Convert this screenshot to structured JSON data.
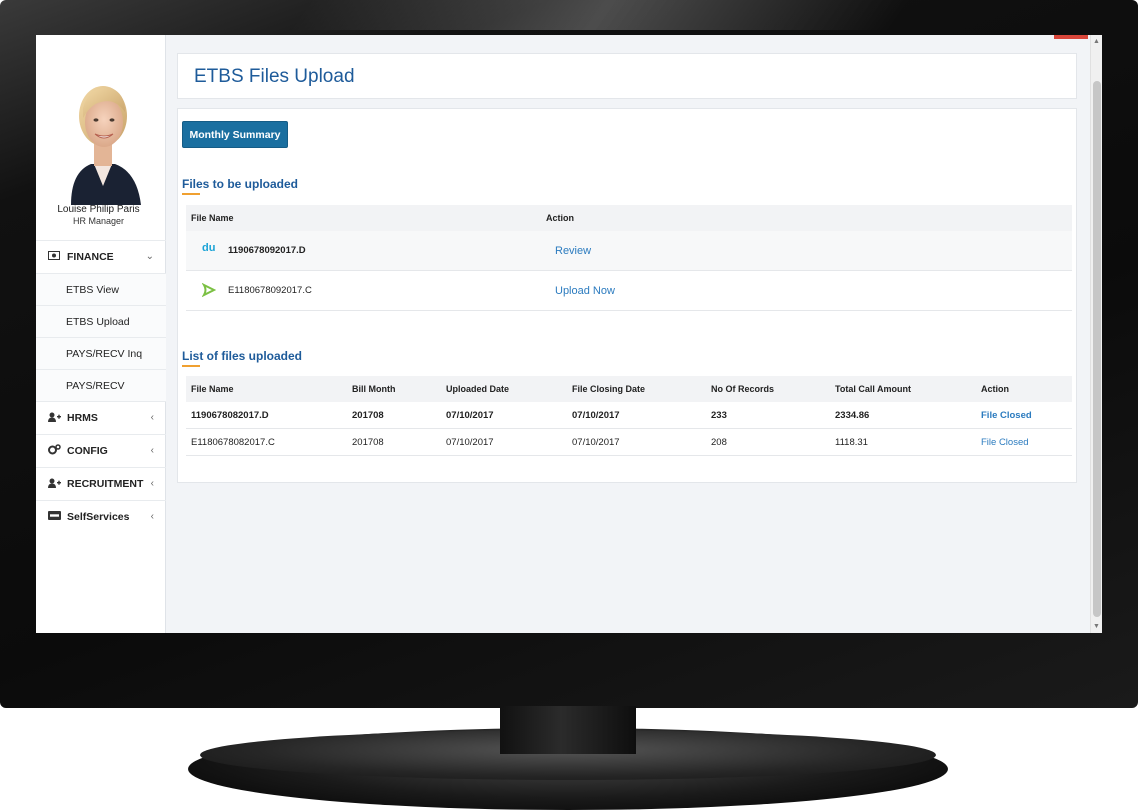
{
  "user": {
    "name": "Louise Philip Paris",
    "role": "HR Manager"
  },
  "sidebar": {
    "items": [
      {
        "label": "FINANCE",
        "icon": "money-icon",
        "chevron": "down"
      },
      {
        "label": "ETBS View"
      },
      {
        "label": "ETBS Upload"
      },
      {
        "label": "PAYS/RECV Inq"
      },
      {
        "label": "PAYS/RECV"
      },
      {
        "label": "HRMS",
        "icon": "user-plus-icon",
        "chevron": "left"
      },
      {
        "label": "CONFIG",
        "icon": "gears-icon",
        "chevron": "left"
      },
      {
        "label": "RECRUITMENT",
        "icon": "user-plus-icon",
        "chevron": "left"
      },
      {
        "label": "SelfServices",
        "icon": "visa-card-icon",
        "chevron": "left"
      }
    ]
  },
  "page": {
    "title": "ETBS Files Upload"
  },
  "actions": {
    "monthly_summary": "Monthly Summary"
  },
  "pending": {
    "title": "Files to be uploaded",
    "columns": {
      "file_name": "File Name",
      "action": "Action"
    },
    "rows": [
      {
        "file_name": "1190678092017.D",
        "action": "Review",
        "provider_icon": "du-icon"
      },
      {
        "file_name": "E1180678092017.C",
        "action": "Upload Now",
        "provider_icon": "etisalat-icon"
      }
    ]
  },
  "uploaded": {
    "title": "List of files uploaded",
    "columns": {
      "file_name": "File Name",
      "bill_month": "Bill Month",
      "uploaded_date": "Uploaded Date",
      "closing_date": "File Closing Date",
      "records": "No Of Records",
      "amount": "Total Call Amount",
      "action": "Action"
    },
    "rows": [
      {
        "file_name": "1190678082017.D",
        "bill_month": "201708",
        "uploaded_date": "07/10/2017",
        "closing_date": "07/10/2017",
        "records": "233",
        "amount": "2334.86",
        "action": "File Closed"
      },
      {
        "file_name": "E1180678082017.C",
        "bill_month": "201708",
        "uploaded_date": "07/10/2017",
        "closing_date": "07/10/2017",
        "records": "208",
        "amount": "1118.31",
        "action": "File Closed"
      }
    ]
  },
  "colors": {
    "accent": "#1e5b9a",
    "button": "#1a6fa0",
    "underline": "#f0a030",
    "link": "#2b7bbf"
  }
}
